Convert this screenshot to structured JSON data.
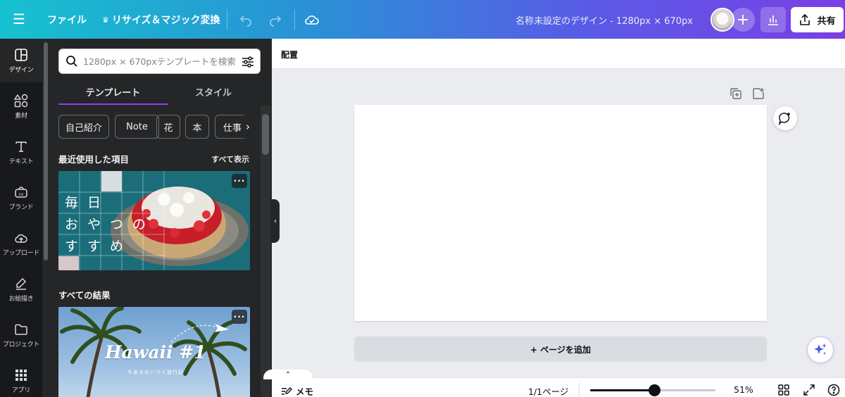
{
  "topbar": {
    "file_label": "ファイル",
    "resize_label": "リサイズ＆マジック変換",
    "design_title": "名称未設定のデザイン - 1280px × 670px",
    "share_label": "共有",
    "plus_label": "+"
  },
  "rail": {
    "items": [
      {
        "label": "デザイン",
        "icon": "layout-icon"
      },
      {
        "label": "素材",
        "icon": "shapes-icon"
      },
      {
        "label": "テキスト",
        "icon": "text-icon"
      },
      {
        "label": "ブランド",
        "icon": "brand-icon"
      },
      {
        "label": "アップロード",
        "icon": "upload-cloud-icon"
      },
      {
        "label": "お絵描き",
        "icon": "draw-icon"
      },
      {
        "label": "プロジェクト",
        "icon": "folder-icon"
      },
      {
        "label": "アプリ",
        "icon": "apps-grid-icon"
      }
    ]
  },
  "panel": {
    "search_placeholder": "1280px × 670pxテンプレートを検索",
    "tabs": [
      {
        "label": "テンプレート",
        "active": true
      },
      {
        "label": "スタイル",
        "active": false
      }
    ],
    "chips": [
      "自己紹介",
      "Note",
      "花",
      "本",
      "仕事"
    ],
    "recent_heading": "最近使用した項目",
    "show_all": "すべて表示",
    "all_results_heading": "すべての結果",
    "recent_card": {
      "line1": "毎日",
      "line2": "おやつの",
      "line3": "すすめ",
      "more": "···"
    },
    "result_card": {
      "title": "Hawaii #1",
      "subtitle": "ちあきのハワイ旅行記",
      "more": "···"
    }
  },
  "editor": {
    "position_label": "配置",
    "add_page_label": "+ ページを追加",
    "collapse_arrow": "‹",
    "bottom": {
      "memo_label": "メモ",
      "page_indicator": "1/1ページ",
      "zoom_value": "51%",
      "zoom_fraction": 0.51
    }
  },
  "colors": {
    "accent": "#8b3dff",
    "topbar_start": "#16c2cf",
    "topbar_end": "#7b3fe4"
  }
}
